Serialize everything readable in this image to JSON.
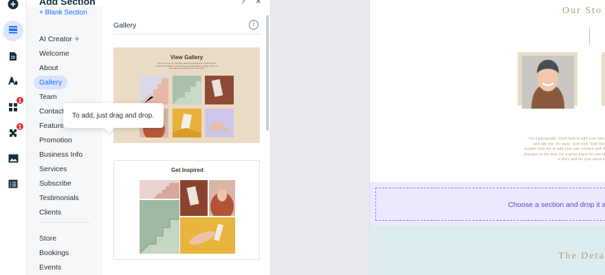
{
  "rail": {
    "items": [
      {
        "name": "add-elements",
        "icon": "plus-circle-icon"
      },
      {
        "name": "add-section",
        "icon": "sections-icon",
        "active": true
      },
      {
        "name": "pages",
        "icon": "page-icon"
      },
      {
        "name": "design",
        "icon": "theme-icon"
      },
      {
        "name": "apps",
        "icon": "apps-icon",
        "badge": "1"
      },
      {
        "name": "business-tools",
        "icon": "puzzle-icon",
        "badge": "1"
      },
      {
        "name": "media",
        "icon": "image-icon"
      },
      {
        "name": "cms",
        "icon": "table-icon"
      }
    ]
  },
  "panel": {
    "title": "Add Section",
    "help": "?",
    "close": "×",
    "blank_section": "+ Blank Section",
    "categories": [
      "AI Creator",
      "Welcome",
      "About",
      "Gallery",
      "Team",
      "Contact",
      "Features",
      "Promotion",
      "Business Info",
      "Services",
      "Subscribe",
      "Testimonials",
      "Clients",
      "Store",
      "Bookings",
      "Events"
    ],
    "selected_category": "Gallery",
    "ai_icon": "sparkle-icon",
    "section_title": "Gallery",
    "info": "i",
    "card1": {
      "title": "View Gallery",
      "subtitle": "This is the space to introduce visitors to the business or brand. Briefly explain who's behind it, what it does and what makes it unique. Share its core values and what this site has to offer."
    },
    "card2": {
      "title": "Get Inspired"
    }
  },
  "tooltip": {
    "text": "To add, just drag and drop."
  },
  "canvas": {
    "story_title": "Our Sto",
    "paragraph": "I'm a paragraph. Click here to add your own text and edit me. It's easy. Just click \"Edit Text\" or double click me to add your own content and make changes to the font. I'm a great place for you to tell a story and let your users know",
    "drop_text": "Choose a section and drop it an",
    "details_title": "The Deta"
  },
  "colors": {
    "accent": "#116dff",
    "gold": "#b9976a",
    "drop_zone": "#ece9ff",
    "badge": "#df3131"
  }
}
